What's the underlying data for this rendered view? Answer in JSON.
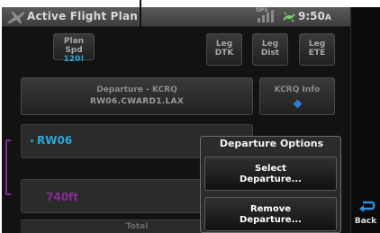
{
  "window": {
    "title": "Active Flight Plan"
  },
  "status": {
    "gps_label": "GPS",
    "time": "9:50",
    "time_suffix": "A"
  },
  "header_buttons": {
    "plan_speed": {
      "label": "Plan Spd",
      "value": "120!"
    },
    "leg_dtk": {
      "line1": "Leg",
      "line2": "DTK"
    },
    "leg_dist": {
      "line1": "Leg",
      "line2": "Dist"
    },
    "leg_ete": {
      "line1": "Leg",
      "line2": "ETE"
    }
  },
  "departure": {
    "title": "Departure - KCRQ",
    "procedure": "RW06.CWARD1.LAX"
  },
  "airport_info": {
    "label": "KCRQ Info"
  },
  "rows": [
    {
      "label": "RW06"
    },
    {
      "label": "740ft"
    }
  ],
  "footer": {
    "total": "Total"
  },
  "departure_options": {
    "title": "Departure Options",
    "select": {
      "line1": "Select",
      "line2": "Departure..."
    },
    "remove": {
      "line1": "Remove",
      "line2": "Departure..."
    }
  },
  "back": {
    "label": "Back"
  },
  "colors": {
    "accent_cyan": "#2aa6d8",
    "magenta": "#8a2a9a",
    "diamond_blue": "#2a7bd6"
  },
  "icons": [
    "plane-icon",
    "gps-signal-icon",
    "satellite-icon",
    "back-arrow-icon",
    "waypoint-diamond-icon"
  ]
}
